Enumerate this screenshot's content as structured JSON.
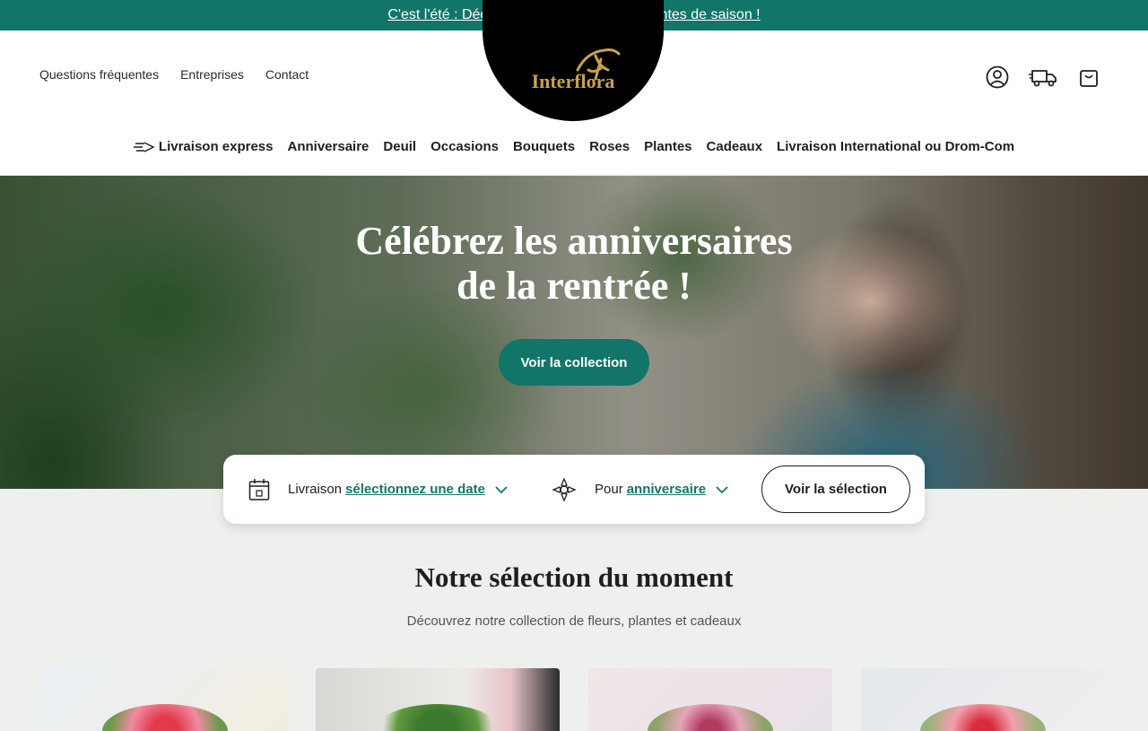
{
  "promo": {
    "text": "C'est l'été : Découvrez nos bouquets et plantes de saison !"
  },
  "header": {
    "top_links": [
      "Questions fréquentes",
      "Entreprises",
      "Contact"
    ],
    "logo_text": "Interflora"
  },
  "nav": {
    "items": [
      "Livraison express",
      "Anniversaire",
      "Deuil",
      "Occasions",
      "Bouquets",
      "Roses",
      "Plantes",
      "Cadeaux",
      "Livraison International ou Drom-Com"
    ]
  },
  "hero": {
    "title_line1": "Célébrez les anniversaires",
    "title_line2": "de la rentrée !",
    "cta": "Voir la collection"
  },
  "search": {
    "delivery_label": "Livraison",
    "delivery_value": "sélectionnez une date",
    "for_label": "Pour",
    "for_value": "anniversaire",
    "button": "Voir la sélection"
  },
  "selection": {
    "title": "Notre sélection du moment",
    "subtitle": "Découvrez notre collection de fleurs, plantes et cadeaux"
  },
  "colors": {
    "accent": "#12756a",
    "logo_gold": "#c9a24a"
  }
}
